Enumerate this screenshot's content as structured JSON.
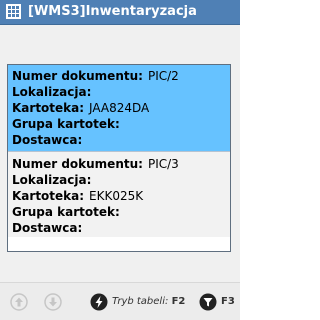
{
  "window": {
    "title": "[WMS3]Inwentaryzacja",
    "icon": "grid-icon",
    "colors": {
      "titlebar": "#4f80b5",
      "selected_row": "#66c2ff",
      "normal_row": "#f2f2f2"
    }
  },
  "records": [
    {
      "selected": true,
      "fields": [
        {
          "label": "Numer dokumentu:",
          "value": "PIC/2"
        },
        {
          "label": "Lokalizacja:",
          "value": ""
        },
        {
          "label": "Kartoteka:",
          "value": "JAA824DA"
        },
        {
          "label": "Grupa kartotek:",
          "value": ""
        },
        {
          "label": "Dostawca:",
          "value": ""
        }
      ]
    },
    {
      "selected": false,
      "fields": [
        {
          "label": "Numer dokumentu:",
          "value": "PIC/3"
        },
        {
          "label": "Lokalizacja:",
          "value": ""
        },
        {
          "label": "Kartoteka:",
          "value": "EKK025K"
        },
        {
          "label": "Grupa kartotek:",
          "value": ""
        },
        {
          "label": "Dostawca:",
          "value": ""
        }
      ]
    }
  ],
  "toolbar": {
    "up_icon": "arrow-up-icon",
    "down_icon": "arrow-down-icon",
    "table_mode_label": "Tryb tabeli:",
    "table_mode_key": "F2",
    "table_mode_icon": "lightning-icon",
    "filter_key": "F3",
    "filter_icon": "filter-icon"
  }
}
